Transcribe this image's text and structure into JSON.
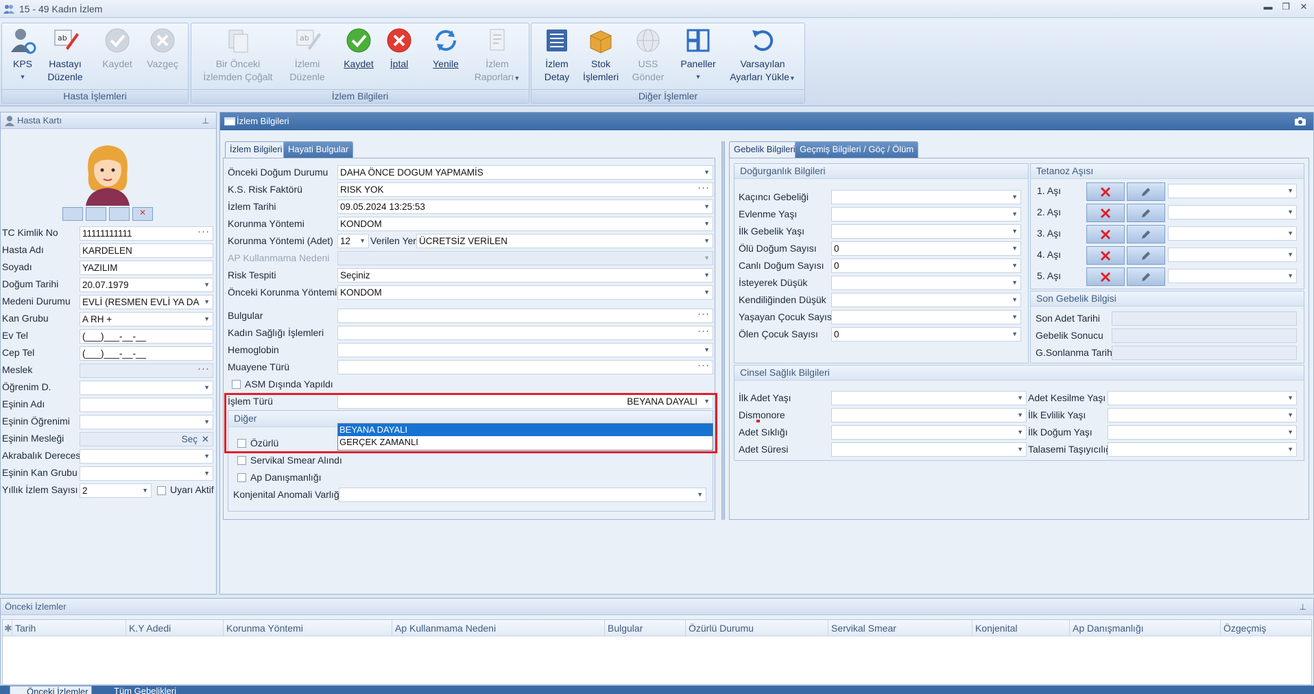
{
  "window": {
    "title": "15 - 49 Kadın İzlem"
  },
  "ribbon": {
    "groups": [
      {
        "caption": "Hasta İşlemleri"
      },
      {
        "caption": "İzlem Bilgileri"
      },
      {
        "caption": "Diğer İşlemler"
      }
    ],
    "buttons": {
      "kps": "KPS",
      "hastayi_l1": "Hastayı",
      "hastayi_l2": "Düzenle",
      "kaydet1": "Kaydet",
      "vazgec": "Vazgeç",
      "bironceki_l1": "Bir Önceki",
      "bironceki_l2": "İzlemden Çoğalt",
      "izlemi_l1": "İzlemi",
      "izlemi_l2": "Düzenle",
      "kaydet2": "Kaydet",
      "iptal": "İptal",
      "yenile": "Yenile",
      "izlemrap_l1": "İzlem",
      "izlemrap_l2": "Raporları",
      "izlemdet_l1": "İzlem",
      "izlemdet_l2": "Detay",
      "stok_l1": "Stok",
      "stok_l2": "İşlemleri",
      "uss_l1": "USS",
      "uss_l2": "Gönder",
      "paneller": "Paneller",
      "varsayilan_l1": "Varsayılan",
      "varsayilan_l2": "Ayarları Yükle"
    }
  },
  "hasta_karti": {
    "title": "Hasta Kartı",
    "fields": [
      {
        "label": "TC Kimlik No",
        "value": "11111111111"
      },
      {
        "label": "Hasta Adı",
        "value": "KARDELEN"
      },
      {
        "label": "Soyadı",
        "value": "YAZILIM"
      },
      {
        "label": "Doğum Tarihi",
        "value": "20.07.1979"
      },
      {
        "label": "Medeni Durumu",
        "value": "EVLİ (RESMEN EVLİ YA DA E"
      },
      {
        "label": "Kan Grubu",
        "value": "A RH +"
      },
      {
        "label": "Ev Tel",
        "value": "(___)___-__-__"
      },
      {
        "label": "Cep Tel",
        "value": "(___)___-__-__"
      },
      {
        "label": "Meslek",
        "value": ""
      },
      {
        "label": "Öğrenim D.",
        "value": ""
      },
      {
        "label": "Eşinin Adı",
        "value": ""
      },
      {
        "label": "Eşinin Öğrenimi",
        "value": ""
      },
      {
        "label": "Eşinin Mesleği",
        "value": "Seç"
      },
      {
        "label": "Akrabalık Derecesi",
        "value": ""
      },
      {
        "label": "Eşinin Kan Grubu",
        "value": ""
      },
      {
        "label": "Yıllık İzlem Sayısı",
        "value": "2"
      }
    ],
    "uyari_aktif": "Uyarı Aktif"
  },
  "izlem": {
    "title": "İzlem Bilgileri",
    "tabs": [
      "İzlem Bilgileri",
      "Hayati Bulgular"
    ],
    "fields": [
      {
        "label": "Önceki Doğum Durumu",
        "value": "DAHA ÖNCE DOGUM YAPMAMİS"
      },
      {
        "label": "K.S. Risk Faktörü",
        "value": "RISK YOK"
      },
      {
        "label": "İzlem Tarihi",
        "value": "09.05.2024 13:25:53"
      },
      {
        "label": "Korunma Yöntemi",
        "value": "KONDOM"
      },
      {
        "label": "Korunma Yöntemi (Adet)",
        "value": "12"
      },
      {
        "label": "AP Kullanmama Nedeni",
        "value": ""
      },
      {
        "label": "Risk Tespiti",
        "value": "Seçiniz"
      },
      {
        "label": "Önceki Korunma Yöntemi",
        "value": "KONDOM"
      },
      {
        "label": "Bulgular",
        "value": ""
      },
      {
        "label": "Kadın Sağlığı İşlemleri",
        "value": ""
      },
      {
        "label": "Hemoglobin",
        "value": ""
      },
      {
        "label": "Muayene Türü",
        "value": ""
      }
    ],
    "verilen_yer_label": "Verilen Yer",
    "verilen_yer_value": "ÜCRETSİZ VERİLEN",
    "asm_disinda": "ASM Dışında Yapıldı",
    "islem_turu_label": "İşlem Türü",
    "islem_turu_value": "BEYANA DAYALI",
    "diger": "Diğer",
    "ozurlu": "Özürlü",
    "servikal": "Servikal Smear Alındı",
    "ap_danismanligi": "Ap Danışmanlığı",
    "konjenital": "Konjenital Anomali Varlığı",
    "dropdown_options": [
      "BEYANA DAYALI",
      "GERÇEK ZAMANLI"
    ]
  },
  "gebelik": {
    "tabs": [
      "Gebelik Bilgileri",
      "Geçmiş Bilgileri / Göç / Ölüm"
    ],
    "dogurganlik_title": "Doğurganlık Bilgileri",
    "dogurganlik": [
      {
        "label": "Kaçıncı Gebeliği",
        "value": ""
      },
      {
        "label": "Evlenme Yaşı",
        "value": ""
      },
      {
        "label": "İlk Gebelik Yaşı",
        "value": ""
      },
      {
        "label": "Ölü Doğum Sayısı",
        "value": "0"
      },
      {
        "label": "Canlı Doğum Sayısı",
        "value": "0"
      },
      {
        "label": "İsteyerek Düşük",
        "value": ""
      },
      {
        "label": "Kendiliğinden Düşük",
        "value": ""
      },
      {
        "label": "Yaşayan Çocuk Sayısı",
        "value": ""
      },
      {
        "label": "Ölen Çocuk Sayısı",
        "value": "0"
      }
    ],
    "tetanoz_title": "Tetanoz Aşısı",
    "asilar": [
      "1. Aşı",
      "2. Aşı",
      "3. Aşı",
      "4. Aşı",
      "5. Aşı"
    ],
    "son_gebelik_title": "Son Gebelik Bilgisi",
    "son_gebelik": [
      "Son Adet Tarihi",
      "Gebelik Sonucu",
      "G.Sonlanma Tarih"
    ],
    "cinsel_title": "Cinsel Sağlık Bilgileri",
    "cinsel_left": [
      "İlk Adet Yaşı",
      "Dismonore",
      "Adet Sıklığı",
      "Adet Süresi"
    ],
    "cinsel_right": [
      "Adet Kesilme Yaşı",
      "İlk Evlilik Yaşı",
      "İlk Doğum Yaşı",
      "Talasemi Taşıyıcılığı"
    ]
  },
  "onceki_izlemler": {
    "title": "Önceki İzlemler",
    "columns": [
      "Tarih",
      "K.Y Adedi",
      "Korunma Yöntemi",
      "Ap Kullanmama Nedeni",
      "Bulgular",
      "Özürlü Durumu",
      "Servikal Smear",
      "Konjenital",
      "Ap Danışmanlığı",
      "Özgeçmiş"
    ],
    "bottom_tabs": [
      "Önceki İzlemler",
      "Tüm Gebelikleri"
    ]
  },
  "colors": {
    "accent": "#3a6aa6",
    "highlight": "#e0202a",
    "selection": "#1673d1"
  }
}
